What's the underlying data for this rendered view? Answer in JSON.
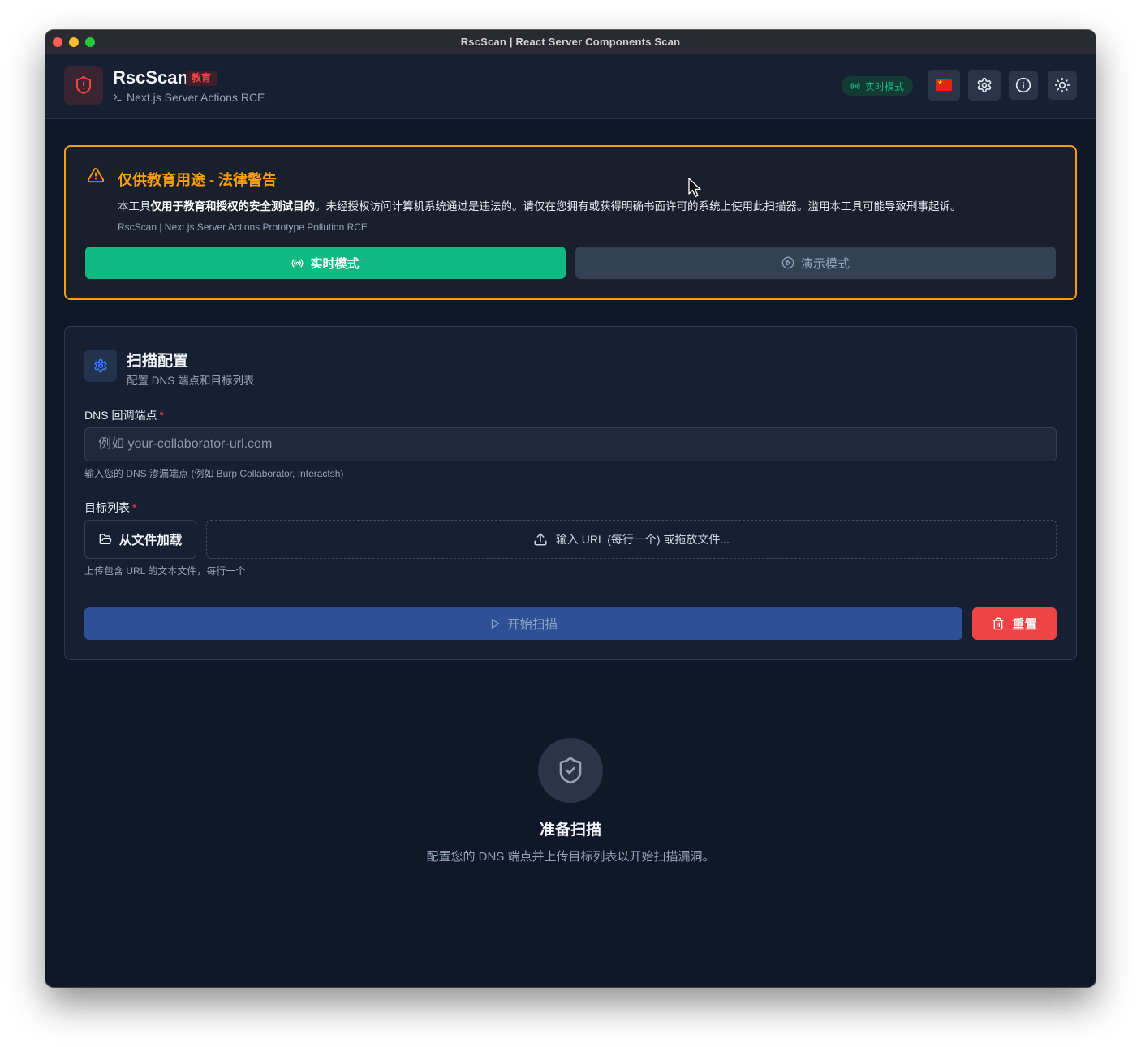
{
  "window": {
    "title": "RscScan | React Server Components Scan"
  },
  "header": {
    "app_name": "RscScan",
    "badge": "教育",
    "subtitle": "Next.js Server Actions RCE",
    "live_pill": "实时模式",
    "icons": [
      "shield-alert-icon",
      "terminal-icon",
      "radio-icon",
      "china-flag-icon",
      "gear-icon",
      "info-icon",
      "sun-icon"
    ]
  },
  "warning": {
    "title": "仅供教育用途 - 法律警告",
    "body_prefix": "本工具",
    "body_bold": "仅用于教育和授权的安全测试目的",
    "body_suffix": "。未经授权访问计算机系统通过是违法的。请仅在您拥有或获得明确书面许可的系统上使用此扫描器。滥用本工具可能导致刑事起诉。",
    "note": "RscScan | Next.js Server Actions Prototype Pollution RCE",
    "live_button": "实时模式",
    "demo_button": "演示模式"
  },
  "config": {
    "title": "扫描配置",
    "subtitle": "配置 DNS 端点和目标列表",
    "dns_label": "DNS 回调端点",
    "required_mark": "*",
    "dns_placeholder": "例如 your-collaborator-url.com",
    "dns_value": "",
    "dns_help": "输入您的 DNS 渗漏端点 (例如 Burp Collaborator, Interactsh)",
    "targets_label": "目标列表",
    "load_file_button": "从文件加载",
    "drop_zone_text": "输入 URL (每行一个) 或拖放文件...",
    "targets_help": "上传包含 URL 的文本文件，每行一个",
    "start_button": "开始扫描",
    "reset_button": "重置"
  },
  "empty_state": {
    "title": "准备扫描",
    "subtitle": "配置您的 DNS 端点并上传目标列表以开始扫描漏洞。"
  },
  "colors": {
    "background": "#0f1729",
    "card": "#172033",
    "accent_green": "#10b981",
    "warning_amber": "#f59e0b",
    "danger_red": "#ef4444",
    "primary_blue": "#2d5096"
  }
}
